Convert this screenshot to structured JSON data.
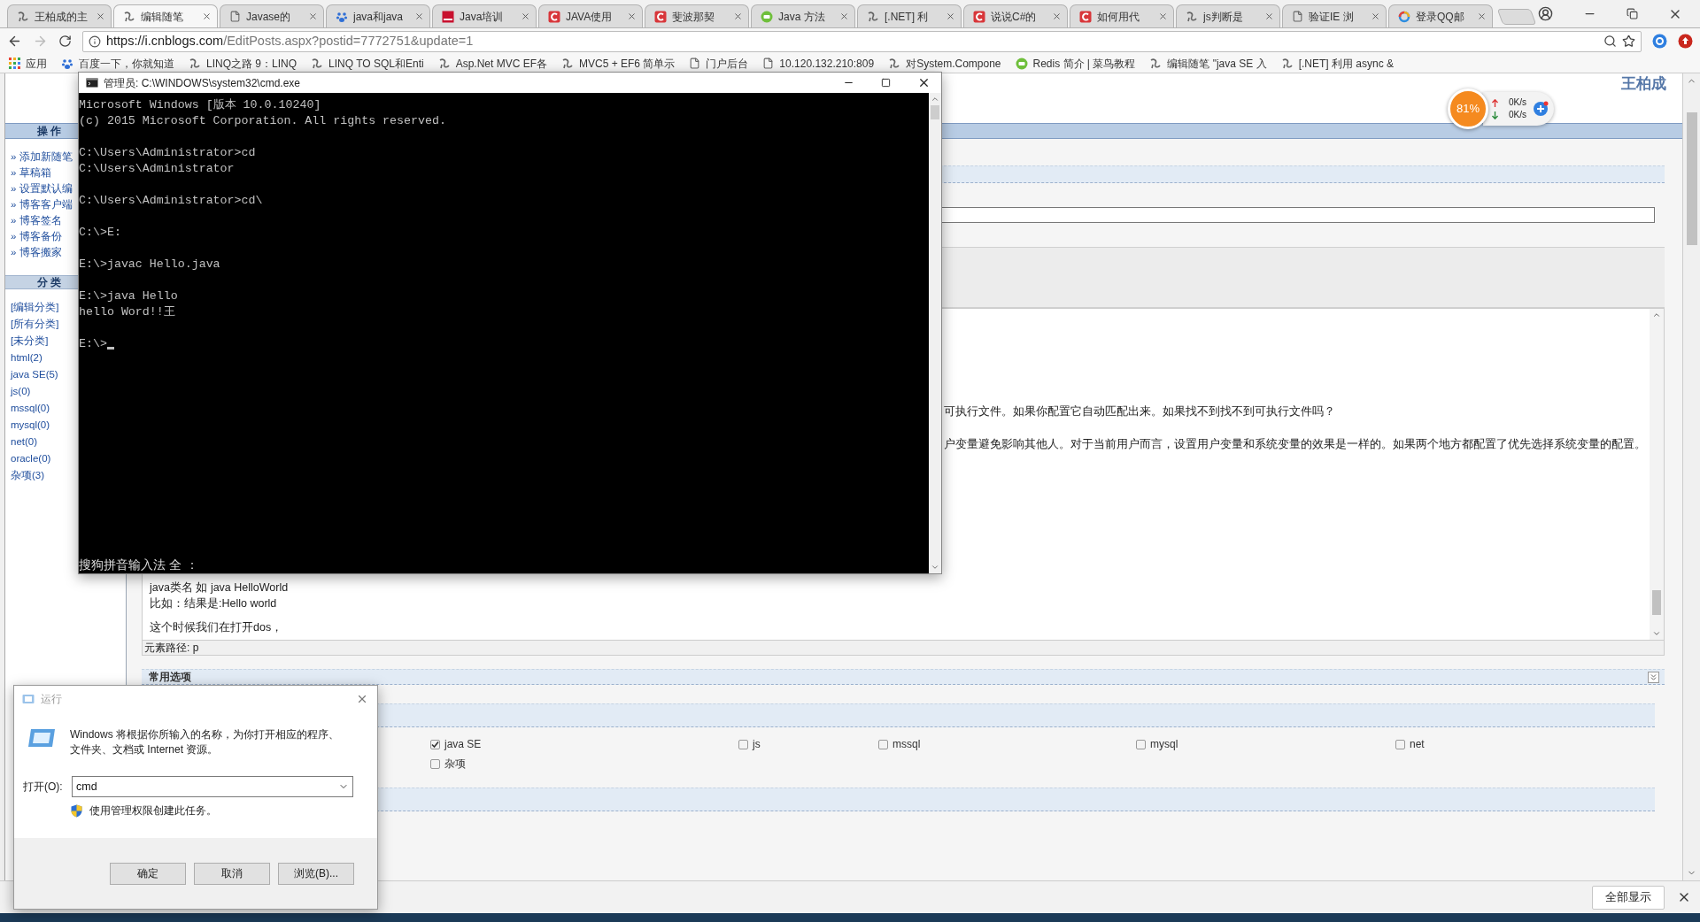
{
  "browser": {
    "tabs": [
      {
        "title": "王柏成的主",
        "kind": "swirl",
        "selected": false
      },
      {
        "title": "编辑随笔",
        "kind": "swirl",
        "selected": true
      },
      {
        "title": "Javase的",
        "kind": "page",
        "selected": false
      },
      {
        "title": "java和java",
        "kind": "paw",
        "selected": false
      },
      {
        "title": "Java培训",
        "kind": "square",
        "selected": false
      },
      {
        "title": "JAVA使用",
        "kind": "c",
        "selected": false
      },
      {
        "title": "斐波那契",
        "kind": "c",
        "selected": false
      },
      {
        "title": "Java 方法",
        "kind": "circle",
        "selected": false
      },
      {
        "title": "[.NET] 利",
        "kind": "swirl",
        "selected": false
      },
      {
        "title": "说说C#的",
        "kind": "c",
        "selected": false
      },
      {
        "title": "如何用代",
        "kind": "c",
        "selected": false
      },
      {
        "title": "js判断是",
        "kind": "swirl",
        "selected": false
      },
      {
        "title": "验证IE 浏",
        "kind": "page",
        "selected": false
      },
      {
        "title": "登录QQ邮",
        "kind": "ring",
        "selected": false
      }
    ],
    "address": {
      "host": "https://i.cnblogs.com",
      "path": "/EditPosts.aspx?postid=7772751&update=1"
    },
    "bookmarks": [
      {
        "label": "应用",
        "kind": "apps"
      },
      {
        "label": "百度一下，你就知道",
        "kind": "paw"
      },
      {
        "label": "LINQ之路 9：LINQ",
        "kind": "swirl"
      },
      {
        "label": "LINQ TO SQL和Enti",
        "kind": "swirl"
      },
      {
        "label": "Asp.Net MVC EF各",
        "kind": "swirl"
      },
      {
        "label": "MVC5 + EF6 简单示",
        "kind": "swirl"
      },
      {
        "label": "门户后台",
        "kind": "page"
      },
      {
        "label": "10.120.132.210:809",
        "kind": "page"
      },
      {
        "label": "对System.Compone",
        "kind": "swirl"
      },
      {
        "label": "Redis 简介 | 菜鸟教程",
        "kind": "circle"
      },
      {
        "label": "编辑随笔 \"java SE 入",
        "kind": "swirl"
      },
      {
        "label": "[.NET] 利用 async &",
        "kind": "swirl"
      }
    ]
  },
  "page": {
    "author": "王柏成",
    "sidebar": {
      "ops_title": "操 作",
      "ops": [
        "» 添加新随笔",
        "» 草稿箱",
        "» 设置默认编",
        "» 博客客户端",
        "» 博客签名",
        "» 博客备份",
        "» 博客搬家"
      ],
      "categories_title": "分 类",
      "categories": [
        "[编辑分类]",
        "[所有分类]",
        "[未分类]",
        "html(2)",
        "java SE(5)",
        "js(0)",
        "mssql(0)",
        "mysql(0)",
        "net(0)",
        "oracle(0)",
        "杂项(3)"
      ]
    },
    "editor": {
      "upper_lines": [
        "可执行文件。如果你配置它自动匹配出来。如果找不到找不到可执行文件吗？",
        "户变量避免影响其他人。对于当前用户而言，设置用户变量和系统变量的效果是一样的。如果两个地方都配置了优先选择系统变量的配置。"
      ],
      "lower_lines": [
        "java类名 如 java HelloWorld",
        "比如：结果是:Hello world",
        "这个时候我们在打开dos，"
      ]
    },
    "element_path": "元素路径: p",
    "options_title": "常用选项",
    "category_checks": [
      {
        "label": "java SE",
        "checked": true
      },
      {
        "label": "js",
        "checked": false
      },
      {
        "label": "mssql",
        "checked": false
      },
      {
        "label": "mysql",
        "checked": false
      },
      {
        "label": "net",
        "checked": false
      },
      {
        "label": "杂项",
        "checked": false
      }
    ]
  },
  "monitor": {
    "percent": "81%",
    "upload": "0K/s",
    "download": "0K/s"
  },
  "download_bar": {
    "button": "全部显示"
  },
  "cmd": {
    "title": "管理员: C:\\WINDOWS\\system32\\cmd.exe",
    "blocks": [
      [
        "Microsoft Windows [版本 10.0.10240]",
        "(c) 2015 Microsoft Corporation. All rights reserved."
      ],
      [
        "C:\\Users\\Administrator>cd",
        "C:\\Users\\Administrator"
      ],
      [
        "C:\\Users\\Administrator>cd\\"
      ],
      [
        "C:\\>E:"
      ],
      [
        "E:\\>javac Hello.java"
      ],
      [
        "E:\\>java Hello",
        "hello Word!!王"
      ]
    ],
    "prompt": "E:\\>",
    "ime_status": "搜狗拼音输入法 全 ："
  },
  "run_dialog": {
    "title": "运行",
    "message": "Windows 将根据你所输入的名称，为你打开相应的程序、文件夹、文档或 Internet 资源。",
    "open_label": "打开(O):",
    "value": "cmd",
    "admin_note": "使用管理权限创建此任务。",
    "buttons": [
      "确定",
      "取消",
      "浏览(B)..."
    ]
  }
}
